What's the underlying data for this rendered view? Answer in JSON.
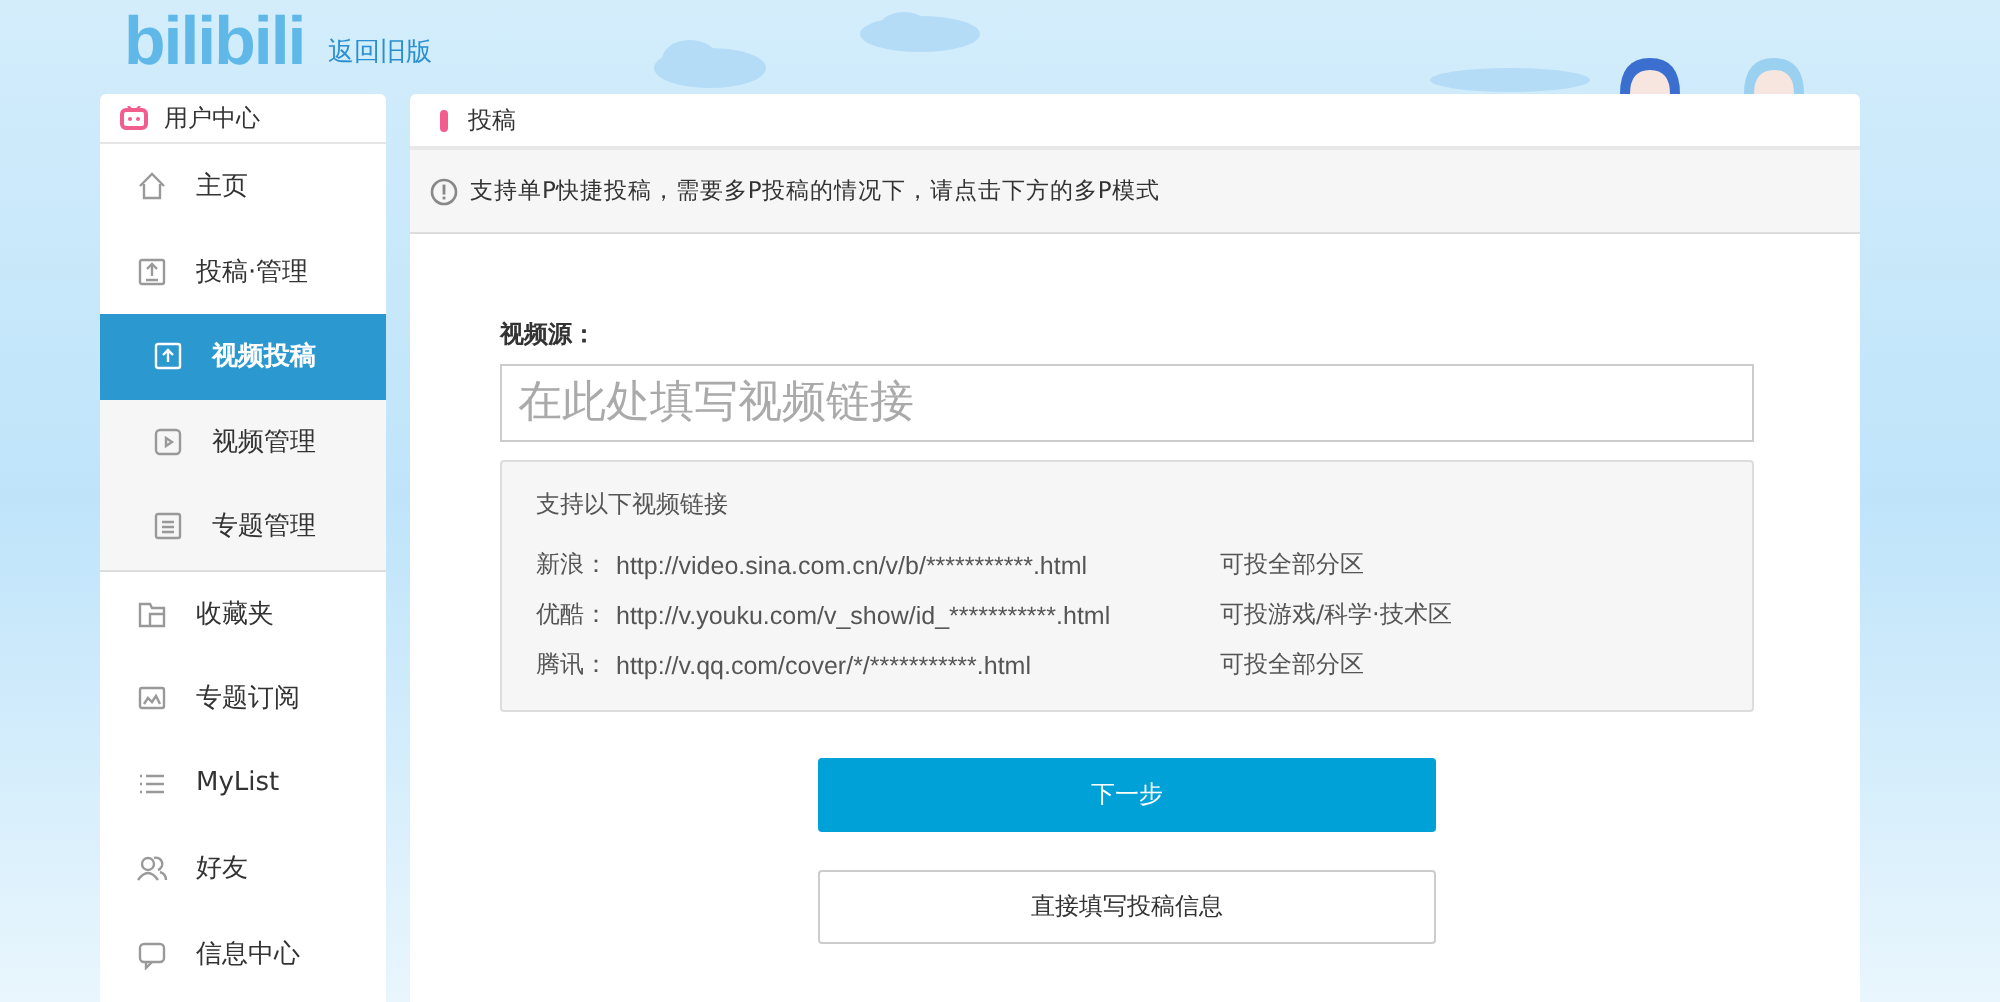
{
  "header": {
    "logo": "bilibili",
    "back_link": "返回旧版"
  },
  "sidebar": {
    "title": "用户中心",
    "items": [
      {
        "label": "主页",
        "kind": "item",
        "selected": false
      },
      {
        "label": "投稿·管理",
        "kind": "item",
        "selected": false
      },
      {
        "label": "视频投稿",
        "kind": "subitem",
        "selected": true
      },
      {
        "label": "视频管理",
        "kind": "subitem",
        "selected": false
      },
      {
        "label": "专题管理",
        "kind": "subitem",
        "selected": false
      },
      {
        "label": "收藏夹",
        "kind": "item",
        "selected": false
      },
      {
        "label": "专题订阅",
        "kind": "item",
        "selected": false
      },
      {
        "label": "MyList",
        "kind": "item",
        "selected": false
      },
      {
        "label": "好友",
        "kind": "item",
        "selected": false
      },
      {
        "label": "信息中心",
        "kind": "item",
        "selected": false
      }
    ]
  },
  "panel": {
    "title": "投稿",
    "notice": "支持单P快捷投稿，需要多P投稿的情况下，请点击下方的多P模式",
    "source_label": "视频源：",
    "source_field": {
      "placeholder": "在此处填写视频链接"
    },
    "supported": {
      "title": "支持以下视频链接",
      "rows": [
        {
          "site": "新浪：",
          "url": "http://video.sina.com.cn/v/b/***********.html",
          "note": "可投全部分区"
        },
        {
          "site": "优酷：",
          "url": "http://v.youku.com/v_show/id_***********.html",
          "note": "可投游戏/科学·技术区"
        },
        {
          "site": "腾讯：",
          "url": "http://v.qq.com/cover/*/***********.html",
          "note": "可投全部分区"
        }
      ]
    },
    "buttons": [
      {
        "label": "下一步",
        "kind": "primary"
      },
      {
        "label": "直接填写投稿信息",
        "kind": "secondary"
      }
    ]
  }
}
